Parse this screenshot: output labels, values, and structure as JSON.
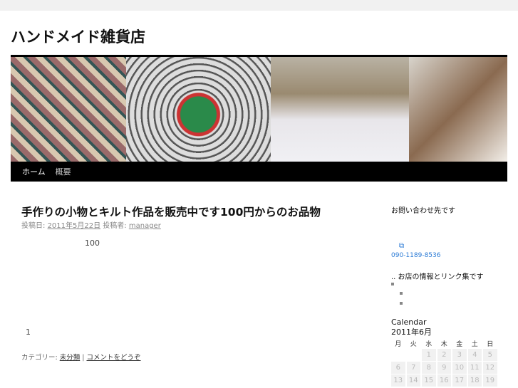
{
  "site": {
    "title": "ハンドメイド雑貨店"
  },
  "nav": {
    "items": [
      {
        "label": "ホーム"
      },
      {
        "label": "概要"
      }
    ]
  },
  "post": {
    "title": "手作りの小物とキルト作品を販売中です100円からのお品物",
    "meta_posted_label": "投稿日:",
    "date": "2011年5月22日",
    "meta_author_label": "投稿者:",
    "author": "manager",
    "body_line1": "100",
    "body_line2": "1",
    "footer_category_label": "カテゴリー:",
    "category": "未分類",
    "comment_link": "コメントをどうぞ"
  },
  "sidebar": {
    "heading1": "お問い合わせ先です",
    "phone": "090-1189-8536",
    "heading2": "お店の情報とリンク集です",
    "prefix": "..",
    "calendar": {
      "title": "Calendar",
      "month": "2011年6月",
      "weekdays": [
        "月",
        "火",
        "水",
        "木",
        "金",
        "土",
        "日"
      ],
      "rows": [
        [
          "",
          "",
          "1",
          "2",
          "3",
          "4",
          "5"
        ],
        [
          "6",
          "7",
          "8",
          "9",
          "10",
          "11",
          "12"
        ],
        [
          "13",
          "14",
          "15",
          "16",
          "17",
          "18",
          "19"
        ]
      ]
    }
  },
  "colors": {
    "link": "#2a7ad5",
    "nav_bg": "#000000"
  }
}
